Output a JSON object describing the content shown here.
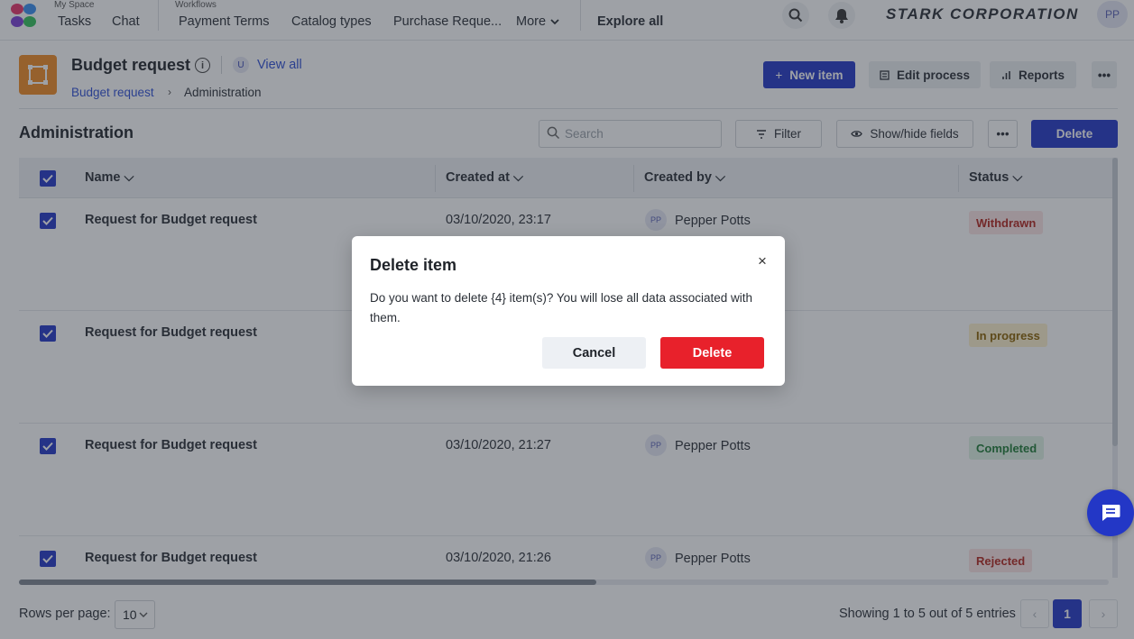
{
  "topnav": {
    "my_space_label": "My Space",
    "tasks": "Tasks",
    "chat": "Chat",
    "workflows_label": "Workflows",
    "workflow_items": [
      "Payment Terms",
      "Catalog types",
      "Purchase Reque..."
    ],
    "more": "More",
    "explore_all": "Explore all",
    "brand": "STARK CORPORATION",
    "user_initials": "PP"
  },
  "header": {
    "title": "Budget request",
    "user_badge": "U",
    "view_all": "View all",
    "breadcrumb": [
      "Budget request",
      "Administration"
    ],
    "new_item": "New item",
    "edit_process": "Edit process",
    "reports": "Reports"
  },
  "toolbar": {
    "section_title": "Administration",
    "search_placeholder": "Search",
    "filter": "Filter",
    "show_hide_fields": "Show/hide fields",
    "delete": "Delete"
  },
  "table": {
    "columns": [
      "Name",
      "Created at",
      "Created by",
      "Status"
    ],
    "rows": [
      {
        "name": "Request for Budget request",
        "created_at": "03/10/2020, 23:17",
        "created_by": "Pepper Potts",
        "initials": "PP",
        "status": "Withdrawn",
        "status_color": "#b3261e",
        "status_bg": "#fbe3e3",
        "selected": true
      },
      {
        "name": "Request for Budget request",
        "created_at": "",
        "created_by": "",
        "initials": "",
        "status": "In progress",
        "status_color": "#8a6100",
        "status_bg": "#fdf0cc",
        "selected": true
      },
      {
        "name": "Request for Budget request",
        "created_at": "03/10/2020, 21:27",
        "created_by": "Pepper Potts",
        "initials": "PP",
        "status": "Completed",
        "status_color": "#1e7a36",
        "status_bg": "#dff3e3",
        "selected": true
      },
      {
        "name": "Request for Budget request",
        "created_at": "03/10/2020, 21:26",
        "created_by": "Pepper Potts",
        "initials": "PP",
        "status": "Rejected",
        "status_color": "#b3261e",
        "status_bg": "#fbe3e3",
        "selected": true
      }
    ]
  },
  "footer": {
    "rows_per_page_label": "Rows per page:",
    "rows_per_page_value": "10",
    "showing": "Showing 1 to 5 out of 5 entries",
    "current_page": "1",
    "prev": "‹",
    "next": "›"
  },
  "modal": {
    "title": "Delete item",
    "message": "Do you want to delete {4} item(s)? You will lose all data associated with them.",
    "cancel": "Cancel",
    "delete": "Delete",
    "close": "×"
  },
  "colors": {
    "primary": "#2337c6",
    "danger": "#e8212b",
    "link": "#2f4fd6",
    "app_icon": "#f08a24"
  }
}
